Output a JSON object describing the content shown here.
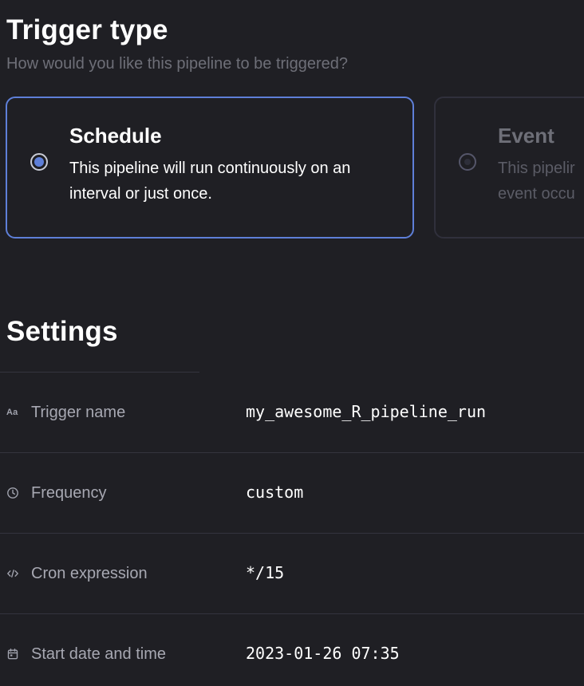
{
  "trigger": {
    "title": "Trigger type",
    "subtitle": "How would you like this pipeline to be triggered?",
    "options": [
      {
        "title": "Schedule",
        "description": "This pipeline will run continuously on an interval or just once.",
        "selected": true
      },
      {
        "title": "Event",
        "description_line1": "This pipelir",
        "description_line2": "event occu",
        "selected": false
      }
    ]
  },
  "settings": {
    "title": "Settings",
    "rows": [
      {
        "icon": "text-aa-icon",
        "icon_text": "Aa",
        "label": "Trigger name",
        "value": "my_awesome_R_pipeline_run"
      },
      {
        "icon": "clock-icon",
        "label": "Frequency",
        "value": "custom"
      },
      {
        "icon": "code-icon",
        "label": "Cron expression",
        "value": "*/15"
      },
      {
        "icon": "calendar-icon",
        "label": "Start date and time",
        "value": "2023-01-26 07:35"
      }
    ]
  },
  "colors": {
    "background": "#1f1f24",
    "accent": "#5e7fd8",
    "muted_text": "#6e6f78",
    "divider": "#34343e"
  }
}
